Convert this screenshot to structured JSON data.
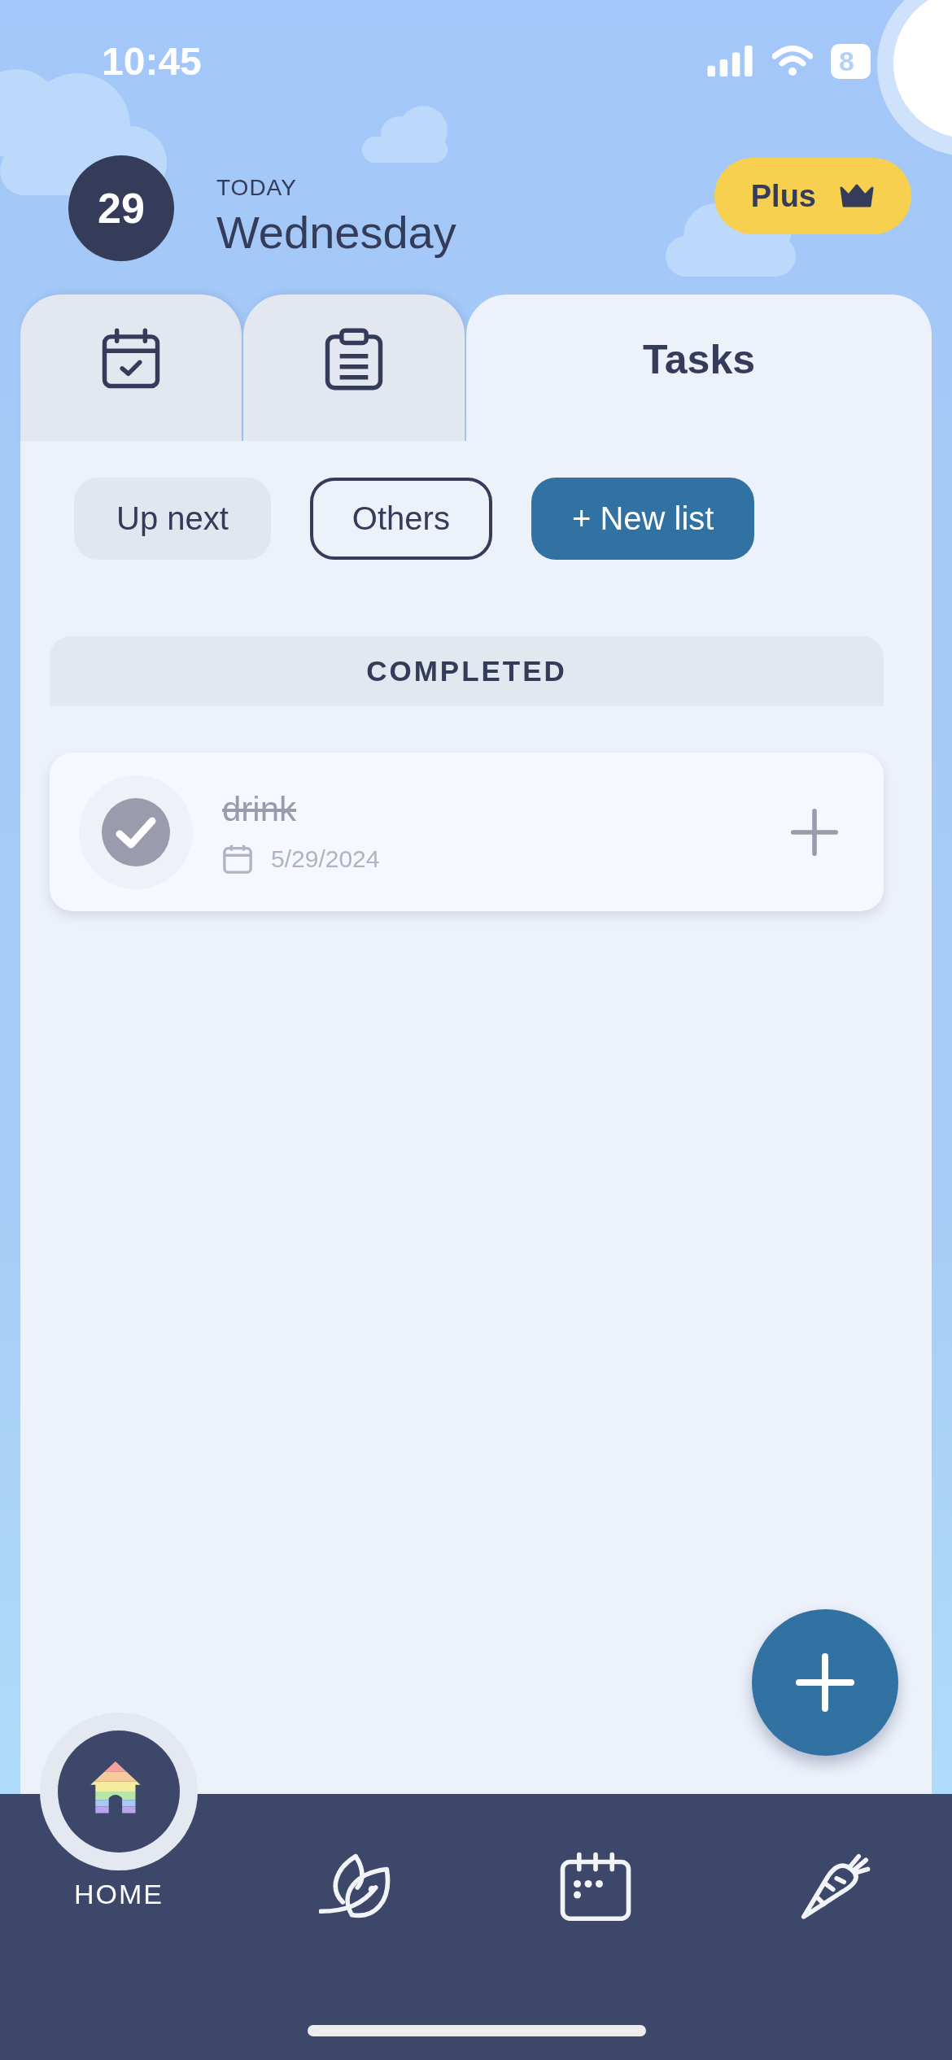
{
  "status_bar": {
    "time": "10:45",
    "battery": "8"
  },
  "header": {
    "date_number": "29",
    "caption": "TODAY",
    "weekday": "Wednesday",
    "plus_button": "Plus"
  },
  "tabs": [
    {
      "kind": "calendar",
      "selected": false
    },
    {
      "kind": "clipboard",
      "selected": false
    },
    {
      "kind": "text",
      "label": "Tasks",
      "selected": true
    }
  ],
  "filters": [
    {
      "label": "Up next",
      "selected": false
    },
    {
      "label": "Others",
      "selected": true
    }
  ],
  "new_list_button": "+ New list",
  "section": {
    "title": "COMPLETED"
  },
  "tasks": [
    {
      "title": "drink",
      "date": "5/29/2024",
      "completed": true
    }
  ],
  "nav": [
    {
      "kind": "home",
      "label": "HOME",
      "selected": true
    },
    {
      "kind": "leaf",
      "selected": false
    },
    {
      "kind": "calendar",
      "selected": false
    },
    {
      "kind": "carrot",
      "selected": false
    }
  ]
}
